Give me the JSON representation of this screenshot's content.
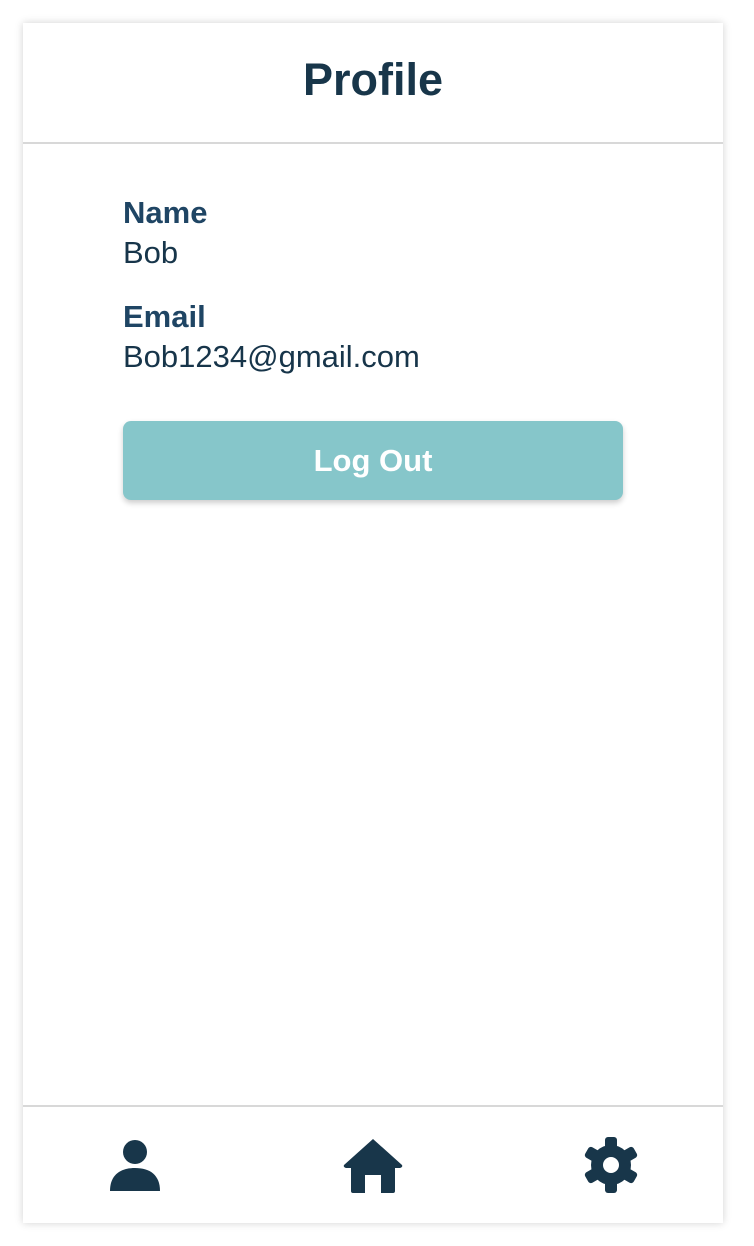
{
  "header": {
    "title": "Profile"
  },
  "profile": {
    "name_label": "Name",
    "name_value": "Bob",
    "email_label": "Email",
    "email_value": "Bob1234@gmail.com"
  },
  "actions": {
    "logout_label": "Log Out"
  },
  "tabbar": {
    "items": [
      {
        "icon": "person-icon"
      },
      {
        "icon": "home-icon"
      },
      {
        "icon": "gear-icon"
      }
    ]
  },
  "colors": {
    "primary_text": "#18364a",
    "label_text": "#1f4564",
    "button_bg": "#86c6ca",
    "button_text": "#ffffff",
    "divider": "#d8d8d8"
  }
}
